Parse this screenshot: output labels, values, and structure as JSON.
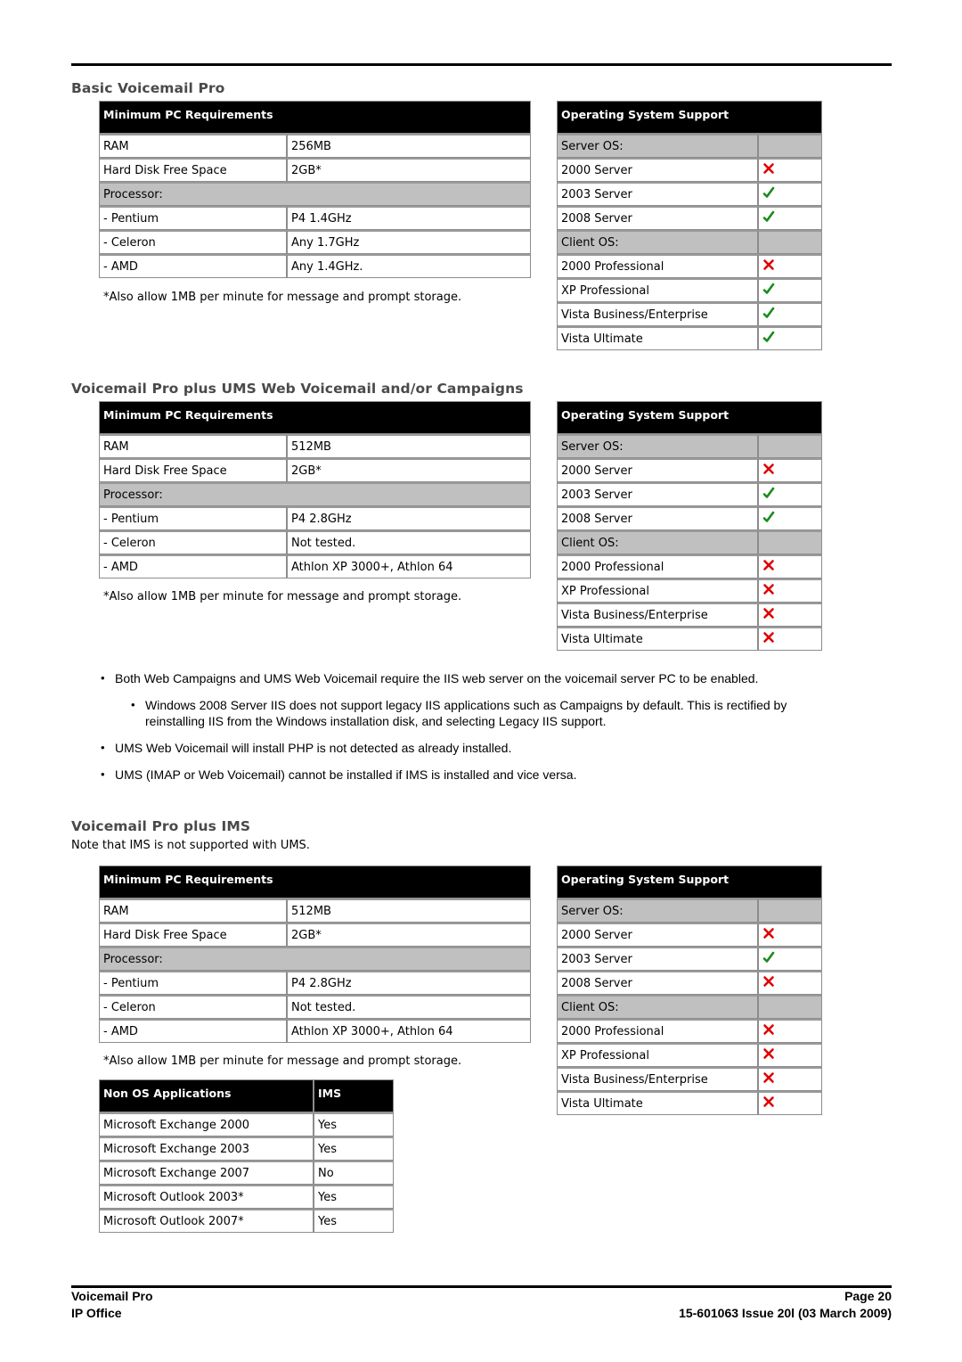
{
  "sections": [
    {
      "title": "Basic Voicemail Pro",
      "requirements": {
        "header": "Minimum PC Requirements",
        "rows": [
          {
            "label": "RAM",
            "value": "256MB"
          },
          {
            "label": "Hard Disk Free Space",
            "value": "2GB*"
          }
        ],
        "processor_label": "Processor:",
        "processors": [
          {
            "label": "- Pentium",
            "value": "P4 1.4GHz"
          },
          {
            "label": "- Celeron",
            "value": "Any 1.7GHz"
          },
          {
            "label": "- AMD",
            "value": "Any 1.4GHz."
          }
        ],
        "footnote": "*Also allow 1MB per minute for message and prompt storage."
      },
      "os_support": {
        "header": "Operating System Support",
        "server_label": "Server OS:",
        "server": [
          {
            "name": "2000 Server",
            "supported": false
          },
          {
            "name": "2003 Server",
            "supported": true
          },
          {
            "name": "2008 Server",
            "supported": true
          }
        ],
        "client_label": "Client OS:",
        "client": [
          {
            "name": "2000 Professional",
            "supported": false
          },
          {
            "name": "XP Professional",
            "supported": true
          },
          {
            "name": "Vista Business/Enterprise",
            "supported": true
          },
          {
            "name": "Vista Ultimate",
            "supported": true
          }
        ]
      }
    },
    {
      "title": "Voicemail Pro plus UMS Web Voicemail and/or Campaigns",
      "requirements": {
        "header": "Minimum PC Requirements",
        "rows": [
          {
            "label": "RAM",
            "value": "512MB"
          },
          {
            "label": "Hard Disk Free Space",
            "value": "2GB*"
          }
        ],
        "processor_label": "Processor:",
        "processors": [
          {
            "label": "- Pentium",
            "value": "P4 2.8GHz"
          },
          {
            "label": "- Celeron",
            "value": "Not tested."
          },
          {
            "label": "- AMD",
            "value": "Athlon XP 3000+, Athlon 64"
          }
        ],
        "footnote": "*Also allow 1MB per minute for message and prompt storage."
      },
      "os_support": {
        "header": "Operating System Support",
        "server_label": "Server OS:",
        "server": [
          {
            "name": "2000 Server",
            "supported": false
          },
          {
            "name": "2003 Server",
            "supported": true
          },
          {
            "name": "2008 Server",
            "supported": true
          }
        ],
        "client_label": "Client OS:",
        "client": [
          {
            "name": "2000 Professional",
            "supported": false
          },
          {
            "name": "XP Professional",
            "supported": false
          },
          {
            "name": "Vista Business/Enterprise",
            "supported": false
          },
          {
            "name": "Vista Ultimate",
            "supported": false
          }
        ]
      },
      "bullets": [
        {
          "text": "Both Web Campaigns and UMS Web Voicemail require the IIS web server on the voicemail server PC to be enabled.",
          "level": 1
        },
        {
          "text": "Windows 2008 Server IIS does not support legacy IIS applications such as Campaigns by default. This is rectified by reinstalling IIS from the Windows installation disk, and selecting Legacy IIS support.",
          "level": 2
        },
        {
          "text": "UMS Web Voicemail will install PHP is not detected as already installed.",
          "level": 1
        },
        {
          "text": "UMS (IMAP or Web Voicemail) cannot be installed if IMS is installed and vice versa.",
          "level": 1
        }
      ]
    },
    {
      "title": "Voicemail Pro plus IMS",
      "note": "Note that IMS is not supported with UMS.",
      "requirements": {
        "header": "Minimum PC Requirements",
        "rows": [
          {
            "label": "RAM",
            "value": "512MB"
          },
          {
            "label": "Hard Disk Free Space",
            "value": "2GB*"
          }
        ],
        "processor_label": "Processor:",
        "processors": [
          {
            "label": "- Pentium",
            "value": "P4 2.8GHz"
          },
          {
            "label": "- Celeron",
            "value": "Not tested."
          },
          {
            "label": "- AMD",
            "value": "Athlon XP 3000+, Athlon 64"
          }
        ],
        "footnote": "*Also allow 1MB per minute for message and prompt storage."
      },
      "os_support": {
        "header": "Operating System Support",
        "server_label": "Server OS:",
        "server": [
          {
            "name": "2000 Server",
            "supported": false
          },
          {
            "name": "2003 Server",
            "supported": true
          },
          {
            "name": "2008 Server",
            "supported": false
          }
        ],
        "client_label": "Client OS:",
        "client": [
          {
            "name": "2000 Professional",
            "supported": false
          },
          {
            "name": "XP Professional",
            "supported": false
          },
          {
            "name": "Vista Business/Enterprise",
            "supported": false
          },
          {
            "name": "Vista Ultimate",
            "supported": false
          }
        ]
      },
      "apps": {
        "header_app": "Non OS Applications",
        "header_ims": "IMS",
        "rows": [
          {
            "name": "Microsoft Exchange 2000",
            "ims": "Yes"
          },
          {
            "name": "Microsoft Exchange 2003",
            "ims": "Yes"
          },
          {
            "name": "Microsoft Exchange 2007",
            "ims": "No"
          },
          {
            "name": "Microsoft Outlook 2003*",
            "ims": "Yes"
          },
          {
            "name": "Microsoft Outlook 2007*",
            "ims": "Yes"
          }
        ]
      }
    }
  ],
  "footer": {
    "product": "Voicemail Pro",
    "system": "IP Office",
    "page": "Page 20",
    "doc_ref": "15-601063 Issue 20l (03 March 2009)"
  },
  "colors": {
    "check": "#1a8a1a",
    "cross": "#e00000",
    "header_bg": "#000000",
    "group_bg": "#c0c0c0",
    "title": "#4a4a4a"
  }
}
